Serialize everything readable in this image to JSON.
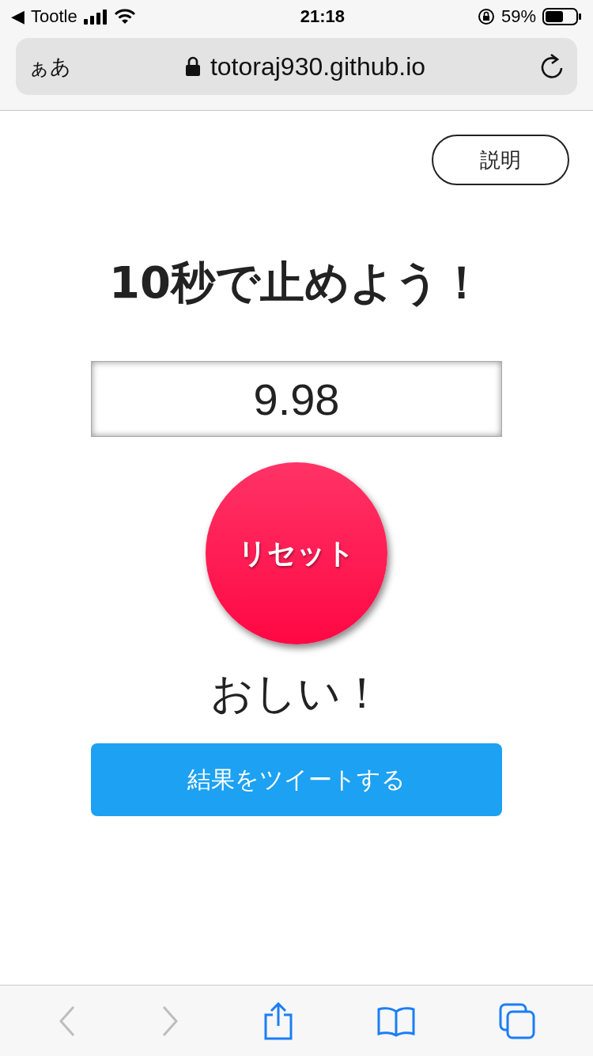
{
  "status_bar": {
    "back_arrow": "◀",
    "back_app": "Tootle",
    "time": "21:18",
    "battery": "59%"
  },
  "address_bar": {
    "text_size": "ぁあ",
    "url": "totoraj930.github.io"
  },
  "help_button": "説明",
  "title": "10秒で止めよう！",
  "timer": "9.98",
  "reset_button": "リセット",
  "result": "おしい！",
  "tweet_button": "結果をツイートする",
  "toolbar": [
    {
      "kind": "back",
      "disabled": true
    },
    {
      "kind": "forward",
      "disabled": true
    },
    {
      "kind": "share",
      "disabled": false
    },
    {
      "kind": "bookmarks",
      "disabled": false
    },
    {
      "kind": "tabs",
      "disabled": false
    }
  ]
}
